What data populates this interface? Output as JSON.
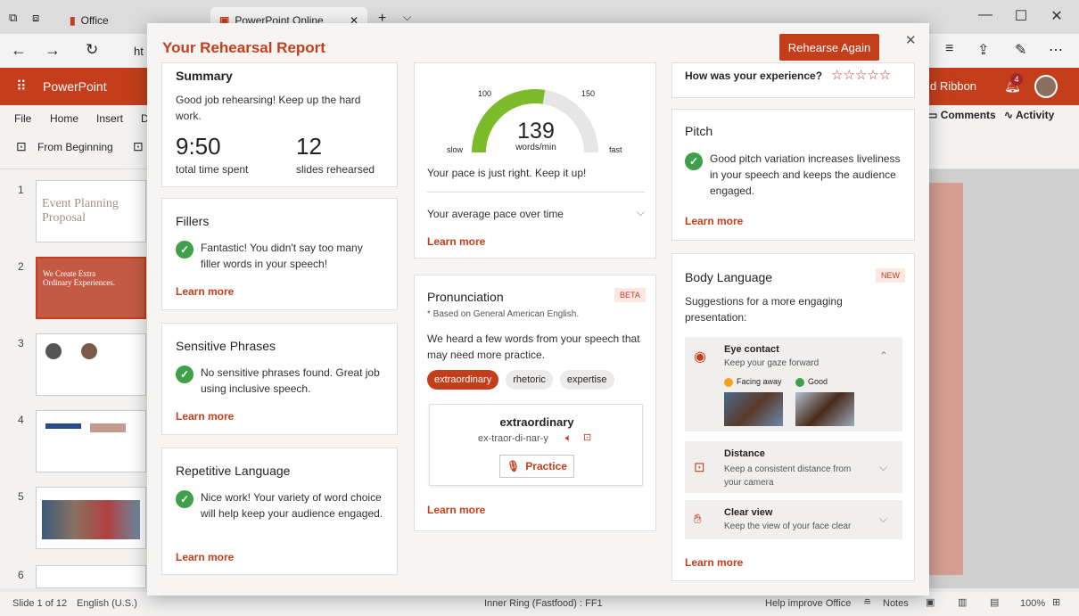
{
  "browser": {
    "tab1": "Office",
    "tab2": "PowerPoint Online",
    "url_prefix": "ht"
  },
  "ppt": {
    "app_name": "PowerPoint",
    "ribbon_right": "d Ribbon",
    "notif_count": "4",
    "menu": [
      "File",
      "Home",
      "Insert",
      "D"
    ],
    "from_beginning": "From Beginning",
    "comments": "Comments",
    "activity": "Activity"
  },
  "thumbs": {
    "numbers": [
      "1",
      "2",
      "3",
      "4",
      "5",
      "6"
    ],
    "slide1_title": "Event Planning Proposal",
    "slide2_title": "We Create Extra Ordinary Experiences."
  },
  "status": {
    "slide": "Slide 1 of 12",
    "lang": "English (U.S.)",
    "ring": "Inner Ring (Fastfood) : FF1",
    "help": "Help improve Office",
    "notes": "Notes",
    "zoom": "100%"
  },
  "modal": {
    "title": "Your Rehearsal Report",
    "rehearse_again": "Rehearse Again",
    "summary": {
      "title": "Summary",
      "text": "Good job rehearsing! Keep up the hard work.",
      "time": "9:50",
      "time_label": "total time spent",
      "slides": "12",
      "slides_label": "slides rehearsed"
    },
    "fillers": {
      "title": "Fillers",
      "text": "Fantastic! You didn't say too many filler words in your speech!",
      "learn": "Learn more"
    },
    "sensitive": {
      "title": "Sensitive Phrases",
      "text": "No sensitive phrases found. Great job using inclusive speech.",
      "learn": "Learn more"
    },
    "repetitive": {
      "title": "Repetitive Language",
      "text": "Nice work! Your variety of word choice will help keep your audience engaged.",
      "learn": "Learn more"
    },
    "pace": {
      "value": "139",
      "unit": "words/min",
      "tick_low": "100",
      "tick_high": "150",
      "slow": "slow",
      "fast": "fast",
      "text": "Your pace is just right. Keep it up!",
      "over_time": "Your average pace over time",
      "learn": "Learn more",
      "fill_fraction": 0.55
    },
    "pronunciation": {
      "title": "Pronunciation",
      "badge": "BETA",
      "note": "* Based on General American English.",
      "text": "We heard a few words from your speech that may need more practice.",
      "words": [
        "extraordinary",
        "rhetoric",
        "expertise"
      ],
      "word": "extraordinary",
      "phonetic": "ex-traor-di-nar-y",
      "practice": "Practice",
      "learn": "Learn more"
    },
    "experience": {
      "question": "How was your experience?",
      "stars": "☆☆☆☆☆"
    },
    "pitch": {
      "title": "Pitch",
      "text": "Good pitch variation increases liveliness in your speech and keeps the audience engaged.",
      "learn": "Learn more"
    },
    "body": {
      "title": "Body Language",
      "badge": "NEW",
      "text": "Suggestions for a more engaging presentation:",
      "eye_title": "Eye contact",
      "eye_sub": "Keep your gaze forward",
      "facing": "Facing away",
      "good": "Good",
      "dist_title": "Distance",
      "dist_sub": "Keep a consistent distance from your camera",
      "clear_title": "Clear view",
      "clear_sub": "Keep the view of your face clear",
      "learn": "Learn more"
    }
  }
}
